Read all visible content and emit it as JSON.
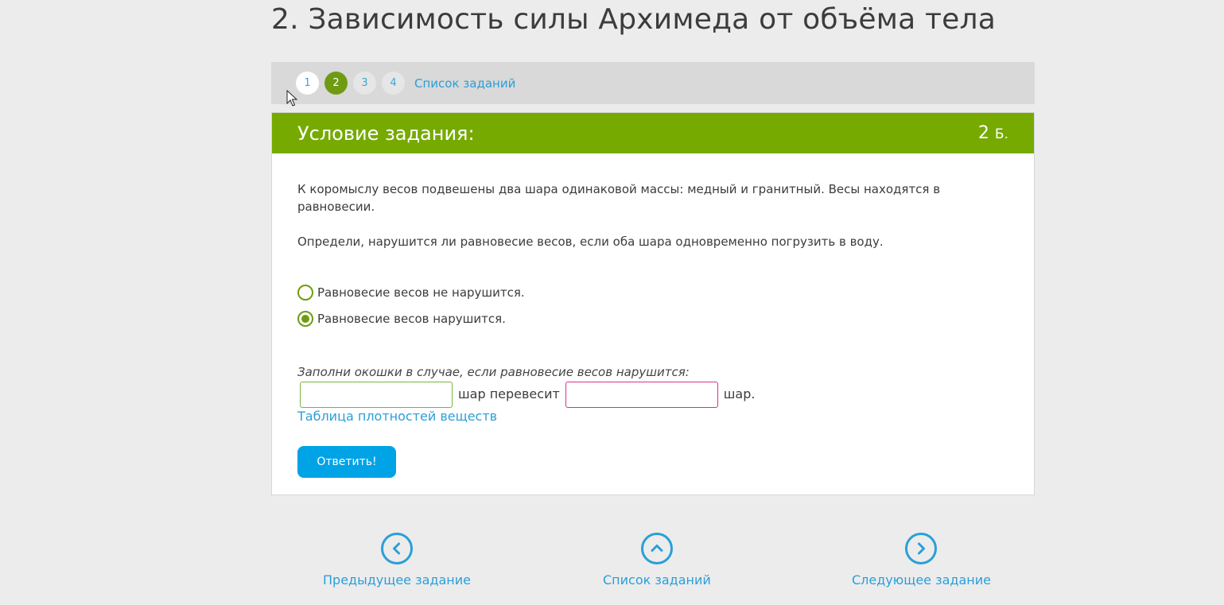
{
  "page_title": "2. Зависимость силы Архимеда от объёма тела",
  "task_nav": {
    "steps": [
      {
        "label": "1",
        "state": "done"
      },
      {
        "label": "2",
        "state": "current"
      },
      {
        "label": "3",
        "state": "pending"
      },
      {
        "label": "4",
        "state": "pending"
      }
    ],
    "task_list_label": "Список заданий"
  },
  "card": {
    "title": "Условие задания:",
    "points_value": "2",
    "points_unit": "Б.",
    "question_1": "К коромыслу весов подвешены два шара одинаковой массы: медный и гранитный. Весы находятся в равновесии.",
    "question_2": "Определи, нарушится ли равновесие весов, если оба шара одновременно погрузить в воду.",
    "options": [
      {
        "label": "Равновесие весов не нарушится.",
        "checked": false
      },
      {
        "label": "Равновесие весов нарушится.",
        "checked": true
      }
    ],
    "hint": "Заполни окошки в случае, если равновесие весов нарушится:",
    "fill": {
      "input_a_value": "",
      "middle_text": "шар перевесит",
      "input_b_value": "",
      "end_text": "шар."
    },
    "density_link": "Таблица плотностей веществ",
    "answer_button": "Ответить!"
  },
  "bottom_nav": {
    "prev_label": "Предыдущее задание",
    "list_label": "Список заданий",
    "next_label": "Следующее задание"
  },
  "colors": {
    "accent_green": "#76aa00",
    "link_blue": "#2a9fd8",
    "button_blue": "#00a3e6"
  }
}
